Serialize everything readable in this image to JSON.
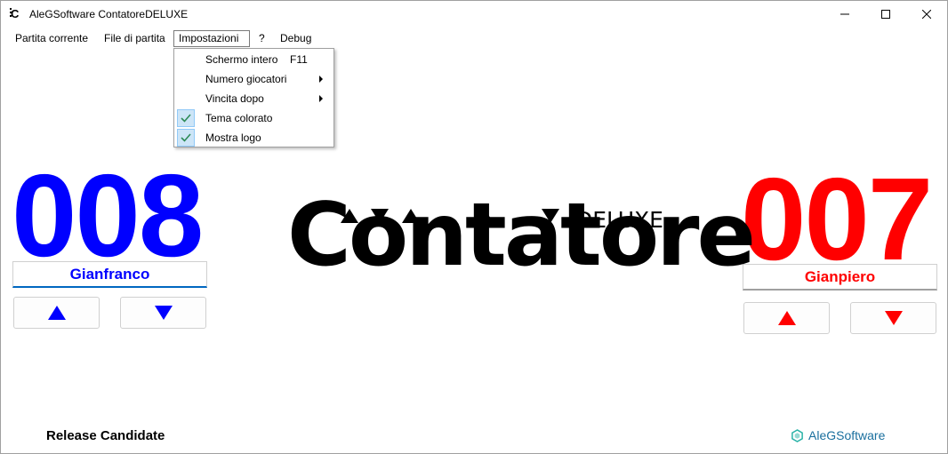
{
  "window": {
    "title": "AleGSoftware ContatoreDELUXE"
  },
  "menu": {
    "items": [
      "Partita corrente",
      "File di partita",
      "Impostazioni",
      "?",
      "Debug"
    ]
  },
  "dropdown": {
    "items": [
      {
        "label": "Schermo intero",
        "shortcut": "F11"
      },
      {
        "label": "Numero giocatori",
        "submenu": true
      },
      {
        "label": "Vincita dopo",
        "submenu": true
      },
      {
        "label": "Tema colorato",
        "checked": true
      },
      {
        "label": "Mostra logo",
        "checked": true
      }
    ]
  },
  "players": [
    {
      "score": "008",
      "name": "Gianfranco",
      "color": "#0000ff"
    },
    {
      "score": "007",
      "name": "Gianpiero",
      "color": "#ff0000"
    }
  ],
  "logo": {
    "main": "Contatore",
    "suffix": "DELUXE"
  },
  "footer": {
    "release": "Release Candidate",
    "brand": "AleGSoftware"
  },
  "colors": {
    "brand": "#1a6f9e",
    "check": "#2e8b57"
  }
}
